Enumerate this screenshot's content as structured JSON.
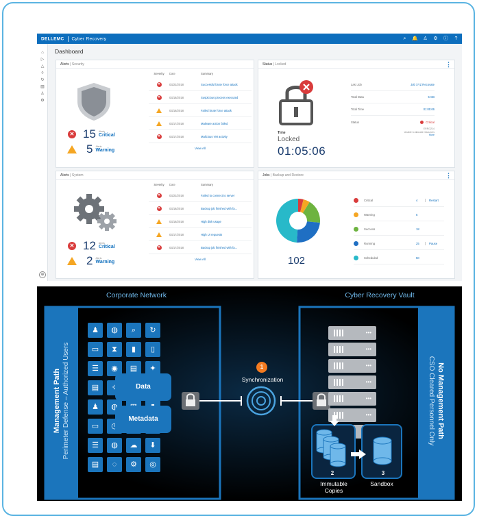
{
  "app": {
    "brand": "DELLEMC",
    "title": "Cyber Recovery",
    "page_title": "Dashboard",
    "icons": [
      "search-icon",
      "alert-badge-icon",
      "user-icon",
      "settings-icon",
      "info-icon",
      "help-icon"
    ],
    "nav_icons": [
      "home-icon",
      "assets-icon",
      "alerts-icon",
      "policies-icon",
      "recovery-icon",
      "reports-icon",
      "users-icon",
      "settings-icon"
    ],
    "collapse_glyph": "⊕"
  },
  "alerts_security": {
    "title": "Alerts",
    "subtitle": "Security",
    "headers": [
      "Severity",
      "Date",
      "Summary"
    ],
    "rows": [
      {
        "sev": "critical",
        "date": "03/22/2018",
        "summary": "Successful brute force attack"
      },
      {
        "sev": "critical",
        "date": "03/18/2018",
        "summary": "Suspicious process executed"
      },
      {
        "sev": "warning",
        "date": "03/18/2018",
        "summary": "Failed brute force attack"
      },
      {
        "sev": "warning",
        "date": "03/17/2018",
        "summary": "Malware action failed"
      },
      {
        "sev": "critical",
        "date": "03/17/2018",
        "summary": "Malicious VM activity"
      }
    ],
    "view_all": "View All",
    "critical_count": "15",
    "critical_small": "Alerts",
    "critical_label": "Critical",
    "warning_count": "5",
    "warning_small": "Alerts",
    "warning_label": "Warning"
  },
  "status": {
    "title": "Status",
    "subtitle": "Locked",
    "time_label": "Time",
    "state": "Locked",
    "clock": "01:05:06",
    "rows": [
      {
        "k": "Last Job",
        "v": "Job XYZ Recovate"
      },
      {
        "k": "Total Data",
        "v": "5 GB"
      },
      {
        "k": "Total Time",
        "v": "01:05:06"
      },
      {
        "k": "Status",
        "v": "Critical"
      }
    ],
    "status_note_1": "ERR/3214",
    "status_note_2": "Unable to allocate resources",
    "status_more": "More"
  },
  "alerts_system": {
    "title": "Alerts",
    "subtitle": "System",
    "headers": [
      "Severity",
      "Date",
      "Summary"
    ],
    "rows": [
      {
        "sev": "critical",
        "date": "03/22/2018",
        "summary": "Failed to connect to server"
      },
      {
        "sev": "critical",
        "date": "03/18/2018",
        "summary": "Backup job finished with fa..."
      },
      {
        "sev": "warning",
        "date": "03/18/2018",
        "summary": "High disk usage"
      },
      {
        "sev": "warning",
        "date": "03/17/2018",
        "summary": "High UI requests"
      },
      {
        "sev": "critical",
        "date": "03/17/2018",
        "summary": "Backup job finished with fa..."
      }
    ],
    "view_all": "View All",
    "critical_count": "12",
    "critical_small": "Alerts",
    "critical_label": "Critical",
    "warning_count": "2",
    "warning_small": "Alerts",
    "warning_label": "Warning"
  },
  "jobs": {
    "title": "Jobs",
    "subtitle": "Backup and Restore",
    "total": "102",
    "rows": [
      {
        "label": "Critical",
        "count": "4",
        "action": "Restart",
        "color": "#d93c3c"
      },
      {
        "label": "Warning",
        "count": "5",
        "action": "",
        "color": "#f5a623"
      },
      {
        "label": "Success",
        "count": "18",
        "action": "",
        "color": "#6db33f"
      },
      {
        "label": "Running",
        "count": "25",
        "action": "Pause",
        "color": "#1f6fc3"
      },
      {
        "label": "Scheduled",
        "count": "50",
        "action": "",
        "color": "#28b9c9"
      }
    ]
  },
  "diagram": {
    "left_title": "Corporate Network",
    "right_title": "Cyber Recovery Vault",
    "left_side_1": "Management Path",
    "left_side_2": "Perimeter Defense – Authorized Users",
    "right_side_1": "No Management Path",
    "right_side_2": "CSO Cleared Personnel Only",
    "data_label": "Data",
    "metadata_label": "Metadata",
    "sync_label": "Synchronization",
    "step1": "1",
    "step2": "2",
    "step3": "3",
    "immutable_1": "Immutable",
    "immutable_2": "Copies",
    "sandbox": "Sandbox"
  },
  "colors": {
    "dell_blue": "#0d6ebd",
    "critical": "#d93c3c",
    "warning": "#f5a623",
    "diagram_blue": "#1b75bc",
    "step_orange": "#f47b20"
  }
}
